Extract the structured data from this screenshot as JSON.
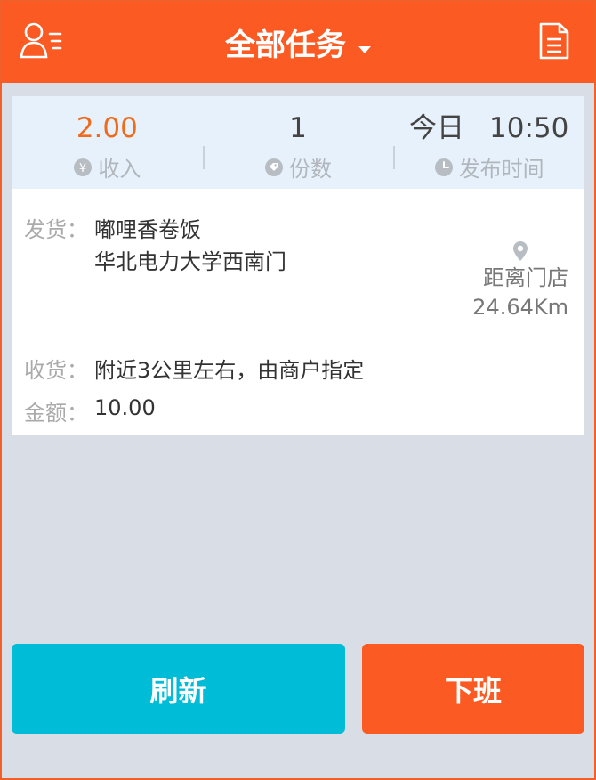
{
  "header": {
    "title": "全部任务",
    "left_icon": "user-list-icon",
    "right_icon": "document-icon",
    "accent_color": "#fc5a23"
  },
  "summary": {
    "income": {
      "value": "2.00",
      "label": "收入",
      "icon": "yen-icon"
    },
    "count": {
      "value": "1",
      "label": "份数",
      "icon": "tag-icon"
    },
    "publish_time": {
      "day": "今日",
      "time": "10:50",
      "label": "发布时间",
      "icon": "clock-icon"
    }
  },
  "order": {
    "ship_label": "发货：",
    "ship_name": "嘟哩香卷饭",
    "ship_address": "华北电力大学西南门",
    "distance_label": "距离门店",
    "distance_value": "24.64Km",
    "receive_label": "收货：",
    "receive_value": "附近3公里左右，由商户指定",
    "amount_label": "金额：",
    "amount_value": "10.00"
  },
  "buttons": {
    "refresh": "刷新",
    "off_work": "下班",
    "refresh_color": "#01bcd6",
    "off_work_color": "#fc5a23"
  }
}
